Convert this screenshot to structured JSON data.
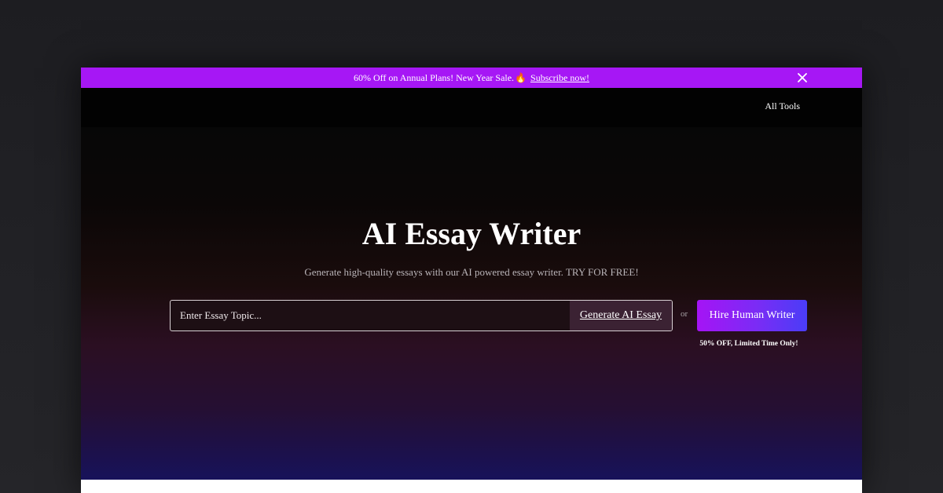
{
  "promo": {
    "text": "60% Off on Annual Plans! New Year Sale.",
    "emoji": "🔥",
    "link_label": "Subscribe now!",
    "close_icon": "close-icon",
    "background": "#a617f5"
  },
  "nav": {
    "all_tools_label": "All Tools"
  },
  "hero": {
    "title": "AI Essay Writer",
    "subtitle": "Generate high-quality essays with our AI powered essay writer. TRY FOR FREE!",
    "search": {
      "value": "",
      "placeholder": "Enter Essay Topic..."
    },
    "generate_label": "Generate AI Essay",
    "or_label": "or",
    "hire_label": "Hire Human Writer",
    "discount_note": "50% OFF, Limited Time Only!"
  },
  "colors": {
    "accent_purple": "#a514f5",
    "accent_blue": "#4a3df7"
  }
}
